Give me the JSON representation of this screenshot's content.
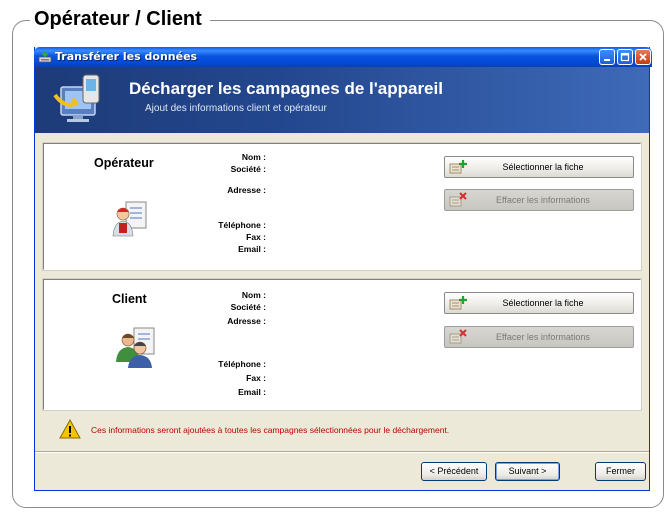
{
  "section_title": "Opérateur / Client",
  "window": {
    "title": "Transférer les données"
  },
  "banner": {
    "title": "Décharger les campagnes de l'appareil",
    "subtitle": "Ajout des informations client et opérateur"
  },
  "operator": {
    "heading": "Opérateur",
    "labels": {
      "name": "Nom :",
      "company": "Société :",
      "address": "Adresse :",
      "phone": "Téléphone :",
      "fax": "Fax :",
      "email": "Email :"
    },
    "select_label": "Sélectionner la fiche",
    "clear_label": "Effacer les informations"
  },
  "client": {
    "heading": "Client",
    "labels": {
      "name": "Nom :",
      "company": "Société :",
      "address": "Adresse :",
      "phone": "Téléphone :",
      "fax": "Fax :",
      "email": "Email :"
    },
    "select_label": "Sélectionner la fiche",
    "clear_label": "Effacer les informations"
  },
  "warning": "Ces informations seront ajoutées à toutes les campagnes sélectionnées pour le déchargement.",
  "nav": {
    "prev_label": "< Précédent",
    "next_label": "Suivant >",
    "close_label": "Fermer"
  },
  "colors": {
    "titlebar": "#0a55e0",
    "banner": "#23478e",
    "window_bg": "#ece9d8",
    "warning_text": "#c00000"
  },
  "icons": {
    "title": "transfer-icon",
    "banner": "device-download-icon",
    "operator": "operator-avatar-icon",
    "client": "client-avatar-icon",
    "select": "add-card-icon",
    "clear": "delete-card-icon",
    "warning": "warning-icon"
  }
}
